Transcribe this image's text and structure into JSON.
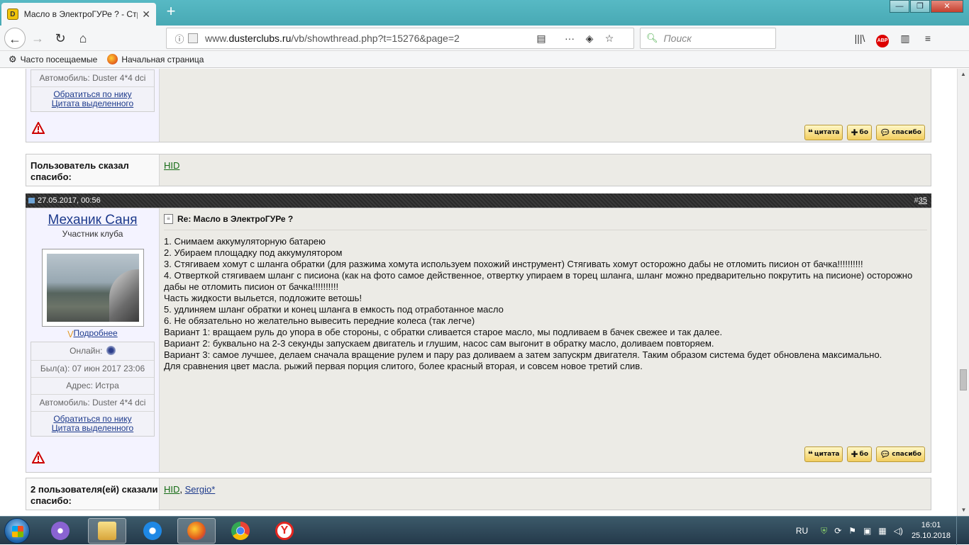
{
  "browser": {
    "tab_title": "Масло в ЭлектроГУРе ? - Стра",
    "tab_close": "✕",
    "new_tab": "+",
    "window_min": "—",
    "window_max": "❐",
    "window_close": "✕",
    "url_prefix": "www.",
    "url_domain": "dusterclubs.ru",
    "url_path": "/vb/showthread.php?t=15276&page=2",
    "search_placeholder": "Поиск",
    "abp_label": "ABP",
    "bookmarks": [
      {
        "label": "Часто посещаемые",
        "icon": "gear-icon"
      },
      {
        "label": "Начальная страница",
        "icon": "firefox-icon"
      }
    ]
  },
  "prev_post": {
    "info_rows": [
      "Автомобиль: Duster 4*4 dci"
    ],
    "link_nick": "Обратиться по нику",
    "link_quote": "Цитата выделенного",
    "buttons": [
      "цитата",
      "бо",
      "спасибо"
    ]
  },
  "thanks_1": {
    "label": "Пользователь сказал спасибо:",
    "users": [
      "HID"
    ]
  },
  "post": {
    "date": "27.05.2017, 00:56",
    "number_prefix": "#",
    "number": "35",
    "username": "Механик Саня",
    "usertitle": "Участник клуба",
    "more_link": "Подробнее",
    "online_label": "Онлайн:",
    "last_seen": "Был(а): 07 июн 2017 23:06",
    "address": "Адрес: Истра",
    "car": "Автомобиль: Duster 4*4 dci",
    "link_nick": "Обратиться по нику",
    "link_quote": "Цитата выделенного",
    "title": "Re: Масло в ЭлектроГУРе ?",
    "body_lines": [
      "1. Снимаем аккумуляторную батарею",
      "2. Убираем площадку под аккумулятором",
      "3. Стягиваем хомут с шланга обратки (для разжима хомута используем похожий инструмент) Стягивать хомут осторожно дабы не отломить писион от бачка!!!!!!!!!!",
      "4. Отверткой стягиваем шланг с писиона (как на фото самое действенное, отвертку упираем в торец шланга, шланг можно предварительно покрутить на писионе) осторожно дабы не отломить писион от бачка!!!!!!!!!!",
      "Часть жидкости выльется, подложите ветошь!",
      "5. удлиняем шланг обратки и конец шланга в емкость под отработанное масло",
      "6. Не обязательно но желательно вывесить передние колеса (так легче)",
      "Вариант 1: вращаем руль до упора в обе стороны, с обратки сливается старое масло, мы подливаем в бачек свежее и так далее.",
      "Вариант 2: буквально на 2-3 секунды запускаем двигатель и глушим, насос сам выгонит в обратку масло, доливаем повторяем.",
      "Вариант 3: самое лучшее, делаем сначала вращение рулем и пару раз доливаем а затем запускрм двигателя. Таким образом система будет обновлена максимально.",
      "Для сравнения цвет масла. рыжий первая порция слитого, более красный вторая, и совсем новое третий слив."
    ],
    "buttons": [
      "цитата",
      "бо",
      "спасибо"
    ]
  },
  "thanks_2": {
    "label": "2 пользователя(ей) сказали спасибо:",
    "users": [
      "HID",
      "Sergio*"
    ],
    "separator": ", "
  },
  "taskbar": {
    "lang": "RU",
    "time": "16:01",
    "date": "25.10.2018"
  },
  "colors": {
    "link_blue": "#1d3a8c",
    "link_green": "#166c16",
    "post_bg": "#ecebe6",
    "userinfo_bg": "#f4f3ff"
  }
}
